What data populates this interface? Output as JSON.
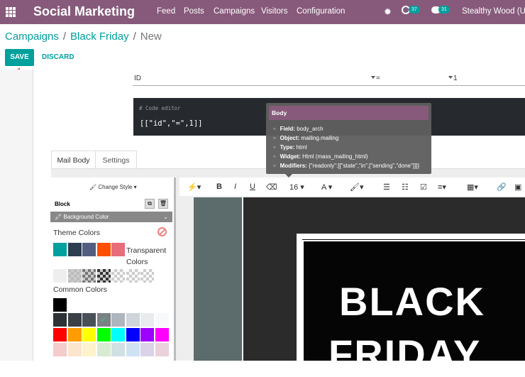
{
  "topbar": {
    "app_title": "Social Marketing",
    "nav": [
      "Feed",
      "Posts",
      "Campaigns",
      "Visitors",
      "Configuration"
    ],
    "activity_count": "37",
    "messages_count": "31",
    "user": "Stealthy Wood (USA)",
    "bg_color": "#875a7b"
  },
  "breadcrumb": {
    "campaigns": "Campaigns",
    "campaign": "Black Friday",
    "current": "New",
    "sep": "/"
  },
  "buttons": {
    "save": "SAVE",
    "discard": "DISCARD"
  },
  "domain": {
    "field": "ID",
    "operator": "=",
    "value": "1"
  },
  "code_editor": {
    "comment": "# Code editor",
    "code": "[[\"id\",\"=\",1]]"
  },
  "tooltip": {
    "title": "Body",
    "items": [
      {
        "key": "Field:",
        "value": "body_arch"
      },
      {
        "key": "Object:",
        "value": "mailing.mailing"
      },
      {
        "key": "Type:",
        "value": "html"
      },
      {
        "key": "Widget:",
        "value": "Html (mass_mailing_html)"
      },
      {
        "key": "Modifiers:",
        "value": "{\"readonly\":[[\"state\",\"in\",[\"sending\",\"done\"]]]}"
      }
    ]
  },
  "tabs": [
    "Mail Body",
    "Settings"
  ],
  "toolbar": {
    "font_size": "16",
    "bold": "B",
    "italic": "I",
    "underline": "U",
    "font_color": "A"
  },
  "panel": {
    "change_style": "Change Style",
    "block": "Block",
    "background_color": "Background Color",
    "theme_colors": "Theme Colors",
    "transparent_colors": "Transparent Colors",
    "common_colors": "Common Colors",
    "theme_swatches": [
      "#00a09d",
      "#2c3e50",
      "#535d80",
      "#fe4f00",
      "#e96c7a"
    ],
    "common_swatches_row1": [
      "#000000",
      "#ffffff"
    ],
    "common_swatches_row2": [
      "#2c3235",
      "#3a4045",
      "#495057",
      "#7b8085",
      "#adb5bd",
      "#ced4da",
      "#e9ecef",
      "#f8f9fa"
    ],
    "common_swatches_row3": [
      "#ff0000",
      "#ff9c00",
      "#ffff00",
      "#00ff00",
      "#00ffff",
      "#0000ff",
      "#9c00ff",
      "#ff00ff"
    ],
    "common_swatches_row4": [
      "#f4cccc",
      "#fce5cd",
      "#fff2cc",
      "#d9ead3",
      "#d0e0e3",
      "#cfe2f3",
      "#d9d2e9",
      "#ead1dc"
    ]
  },
  "hero": {
    "line1": "BLACK",
    "line2": "FRIDAY"
  }
}
